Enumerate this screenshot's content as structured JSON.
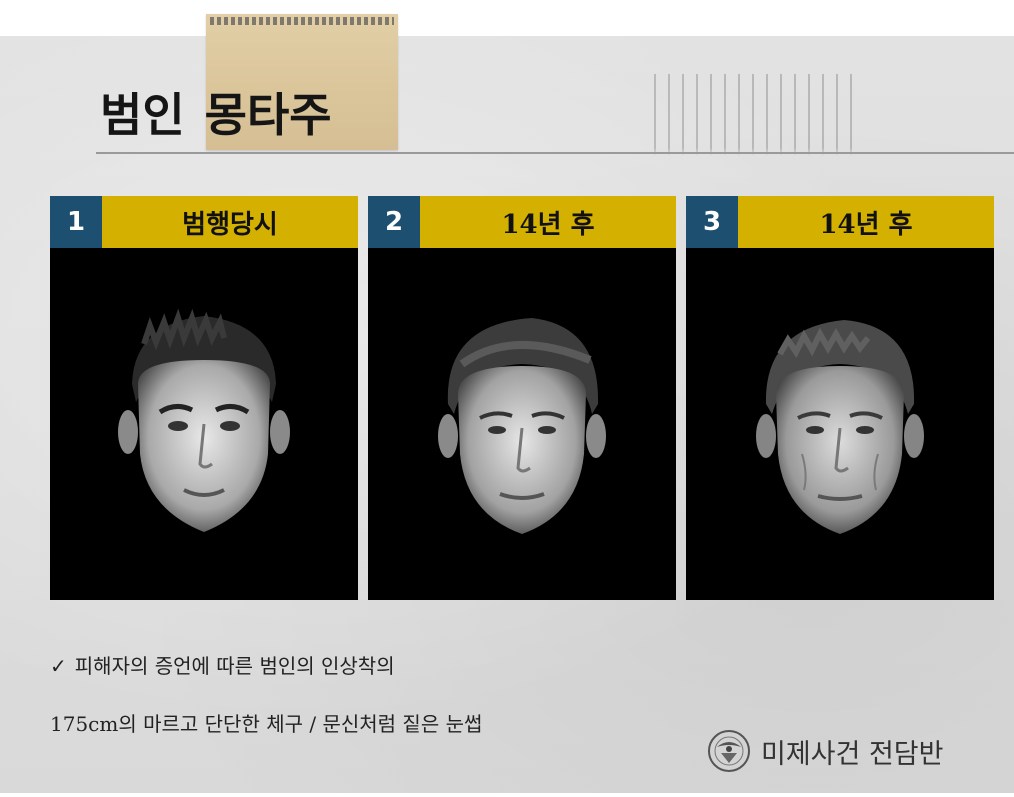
{
  "header": {
    "title_part1": "범인",
    "title_part2": "몽타주"
  },
  "cards": [
    {
      "number": "1",
      "title": "범행당시",
      "image_name": "montage-face-1"
    },
    {
      "number": "2",
      "title": "14년 후",
      "image_name": "montage-face-2"
    },
    {
      "number": "3",
      "title": "14년 후",
      "image_name": "montage-face-3"
    }
  ],
  "notes": {
    "check_icon": "✓",
    "line1": "피해자의 증언에 따른 범인의 인상착의",
    "line2": "175cm의 마르고 단단한 체구 / 문신처럼 짙은 눈썹"
  },
  "brand": {
    "name": "미제사건 전담반",
    "emblem_icon": "police-emblem-icon"
  },
  "colors": {
    "number_bg": "#1d4f71",
    "title_bg": "#d4b000",
    "photo_bg": "#000000",
    "paper_tape": "#d8c29a"
  }
}
